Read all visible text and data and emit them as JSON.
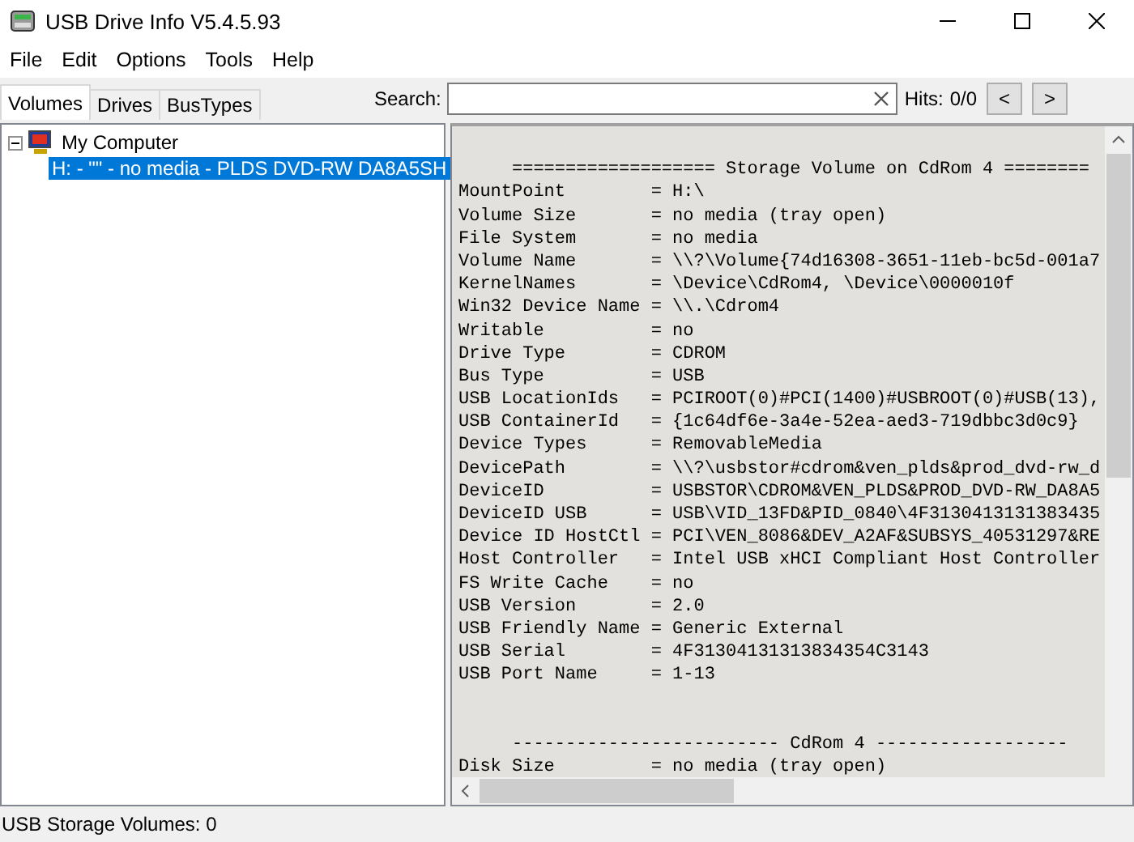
{
  "window": {
    "title": "USB Drive Info V5.4.5.93"
  },
  "menu": [
    "File",
    "Edit",
    "Options",
    "Tools",
    "Help"
  ],
  "tabs": [
    {
      "label": "Volumes",
      "selected": true
    },
    {
      "label": "Drives",
      "selected": false
    },
    {
      "label": "BusTypes",
      "selected": false
    }
  ],
  "search": {
    "label": "Search:",
    "hits_label": "Hits:",
    "hits": "0/0",
    "prev": "<",
    "next": ">"
  },
  "tree": [
    {
      "label": "My Computer",
      "expanded": true,
      "selected": false,
      "children": [
        {
          "label": "H: - \"\" - no media - PLDS DVD-RW DA8A5SH",
          "selected": true
        }
      ]
    }
  ],
  "report": [
    {
      "kind": "blank"
    },
    {
      "kind": "header",
      "text": "     =================== Storage Volume on CdRom 4 ========"
    },
    {
      "kind": "field",
      "key": "MountPoint",
      "value": "= H:\\"
    },
    {
      "kind": "field",
      "key": "Volume Size",
      "value": "= no media (tray open)"
    },
    {
      "kind": "field",
      "key": "File System",
      "value": "= no media"
    },
    {
      "kind": "field",
      "key": "Volume Name",
      "value": "= \\\\?\\Volume{74d16308-3651-11eb-bc5d-001a7"
    },
    {
      "kind": "field",
      "key": "KernelNames",
      "value": "= \\Device\\CdRom4, \\Device\\0000010f"
    },
    {
      "kind": "field",
      "key": "Win32 Device Name",
      "value": "= \\\\.\\Cdrom4"
    },
    {
      "kind": "field",
      "key": "Writable",
      "value": "= no"
    },
    {
      "kind": "field",
      "key": "Drive Type",
      "value": "= CDROM"
    },
    {
      "kind": "field",
      "key": "Bus Type",
      "value": "= USB"
    },
    {
      "kind": "field",
      "key": "USB LocationIds",
      "value": "= PCIROOT(0)#PCI(1400)#USBROOT(0)#USB(13),"
    },
    {
      "kind": "field",
      "key": "USB ContainerId",
      "value": "= {1c64df6e-3a4e-52ea-aed3-719dbbc3d0c9}"
    },
    {
      "kind": "field",
      "key": "Device Types",
      "value": "= RemovableMedia"
    },
    {
      "kind": "field",
      "key": "DevicePath",
      "value": "= \\\\?\\usbstor#cdrom&ven_plds&prod_dvd-rw_d"
    },
    {
      "kind": "field",
      "key": "DeviceID",
      "value": "= USBSTOR\\CDROM&VEN_PLDS&PROD_DVD-RW_DA8A5"
    },
    {
      "kind": "field",
      "key": "DeviceID USB",
      "value": "= USB\\VID_13FD&PID_0840\\4F3130413131383435"
    },
    {
      "kind": "field",
      "key": "Device ID HostCtl",
      "value": "= PCI\\VEN_8086&DEV_A2AF&SUBSYS_40531297&RE"
    },
    {
      "kind": "field",
      "key": "Host Controller",
      "value": "= Intel USB xHCI Compliant Host Controller"
    },
    {
      "kind": "field",
      "key": "FS Write Cache",
      "value": "= no"
    },
    {
      "kind": "field",
      "key": "USB Version",
      "value": "= 2.0"
    },
    {
      "kind": "field",
      "key": "USB Friendly Name",
      "value": "= Generic External"
    },
    {
      "kind": "field",
      "key": "USB Serial",
      "value": "= 4F31304131313834354C3143"
    },
    {
      "kind": "field",
      "key": "USB Port Name",
      "value": "= 1-13"
    },
    {
      "kind": "blank"
    },
    {
      "kind": "blank"
    },
    {
      "kind": "header",
      "text": "     ------------------------- CdRom 4 ------------------"
    },
    {
      "kind": "field",
      "key": "Disk Size",
      "value": "= no media (tray open)"
    }
  ],
  "status_bar": "USB Storage Volumes: 0"
}
